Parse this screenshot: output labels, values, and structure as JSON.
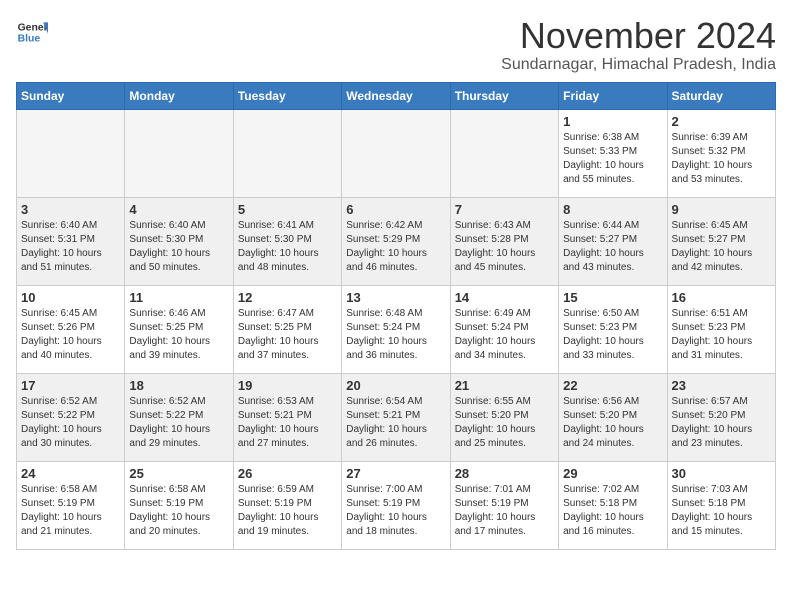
{
  "logo": {
    "line1": "General",
    "line2": "Blue"
  },
  "title": "November 2024",
  "location": "Sundarnagar, Himachal Pradesh, India",
  "weekdays": [
    "Sunday",
    "Monday",
    "Tuesday",
    "Wednesday",
    "Thursday",
    "Friday",
    "Saturday"
  ],
  "weeks": [
    [
      {
        "day": "",
        "empty": true
      },
      {
        "day": "",
        "empty": true
      },
      {
        "day": "",
        "empty": true
      },
      {
        "day": "",
        "empty": true
      },
      {
        "day": "",
        "empty": true
      },
      {
        "day": "1",
        "sunrise": "6:38 AM",
        "sunset": "5:33 PM",
        "daylight": "10 hours and 55 minutes."
      },
      {
        "day": "2",
        "sunrise": "6:39 AM",
        "sunset": "5:32 PM",
        "daylight": "10 hours and 53 minutes."
      }
    ],
    [
      {
        "day": "3",
        "sunrise": "6:40 AM",
        "sunset": "5:31 PM",
        "daylight": "10 hours and 51 minutes."
      },
      {
        "day": "4",
        "sunrise": "6:40 AM",
        "sunset": "5:30 PM",
        "daylight": "10 hours and 50 minutes."
      },
      {
        "day": "5",
        "sunrise": "6:41 AM",
        "sunset": "5:30 PM",
        "daylight": "10 hours and 48 minutes."
      },
      {
        "day": "6",
        "sunrise": "6:42 AM",
        "sunset": "5:29 PM",
        "daylight": "10 hours and 46 minutes."
      },
      {
        "day": "7",
        "sunrise": "6:43 AM",
        "sunset": "5:28 PM",
        "daylight": "10 hours and 45 minutes."
      },
      {
        "day": "8",
        "sunrise": "6:44 AM",
        "sunset": "5:27 PM",
        "daylight": "10 hours and 43 minutes."
      },
      {
        "day": "9",
        "sunrise": "6:45 AM",
        "sunset": "5:27 PM",
        "daylight": "10 hours and 42 minutes."
      }
    ],
    [
      {
        "day": "10",
        "sunrise": "6:45 AM",
        "sunset": "5:26 PM",
        "daylight": "10 hours and 40 minutes."
      },
      {
        "day": "11",
        "sunrise": "6:46 AM",
        "sunset": "5:25 PM",
        "daylight": "10 hours and 39 minutes."
      },
      {
        "day": "12",
        "sunrise": "6:47 AM",
        "sunset": "5:25 PM",
        "daylight": "10 hours and 37 minutes."
      },
      {
        "day": "13",
        "sunrise": "6:48 AM",
        "sunset": "5:24 PM",
        "daylight": "10 hours and 36 minutes."
      },
      {
        "day": "14",
        "sunrise": "6:49 AM",
        "sunset": "5:24 PM",
        "daylight": "10 hours and 34 minutes."
      },
      {
        "day": "15",
        "sunrise": "6:50 AM",
        "sunset": "5:23 PM",
        "daylight": "10 hours and 33 minutes."
      },
      {
        "day": "16",
        "sunrise": "6:51 AM",
        "sunset": "5:23 PM",
        "daylight": "10 hours and 31 minutes."
      }
    ],
    [
      {
        "day": "17",
        "sunrise": "6:52 AM",
        "sunset": "5:22 PM",
        "daylight": "10 hours and 30 minutes."
      },
      {
        "day": "18",
        "sunrise": "6:52 AM",
        "sunset": "5:22 PM",
        "daylight": "10 hours and 29 minutes."
      },
      {
        "day": "19",
        "sunrise": "6:53 AM",
        "sunset": "5:21 PM",
        "daylight": "10 hours and 27 minutes."
      },
      {
        "day": "20",
        "sunrise": "6:54 AM",
        "sunset": "5:21 PM",
        "daylight": "10 hours and 26 minutes."
      },
      {
        "day": "21",
        "sunrise": "6:55 AM",
        "sunset": "5:20 PM",
        "daylight": "10 hours and 25 minutes."
      },
      {
        "day": "22",
        "sunrise": "6:56 AM",
        "sunset": "5:20 PM",
        "daylight": "10 hours and 24 minutes."
      },
      {
        "day": "23",
        "sunrise": "6:57 AM",
        "sunset": "5:20 PM",
        "daylight": "10 hours and 23 minutes."
      }
    ],
    [
      {
        "day": "24",
        "sunrise": "6:58 AM",
        "sunset": "5:19 PM",
        "daylight": "10 hours and 21 minutes."
      },
      {
        "day": "25",
        "sunrise": "6:58 AM",
        "sunset": "5:19 PM",
        "daylight": "10 hours and 20 minutes."
      },
      {
        "day": "26",
        "sunrise": "6:59 AM",
        "sunset": "5:19 PM",
        "daylight": "10 hours and 19 minutes."
      },
      {
        "day": "27",
        "sunrise": "7:00 AM",
        "sunset": "5:19 PM",
        "daylight": "10 hours and 18 minutes."
      },
      {
        "day": "28",
        "sunrise": "7:01 AM",
        "sunset": "5:19 PM",
        "daylight": "10 hours and 17 minutes."
      },
      {
        "day": "29",
        "sunrise": "7:02 AM",
        "sunset": "5:18 PM",
        "daylight": "10 hours and 16 minutes."
      },
      {
        "day": "30",
        "sunrise": "7:03 AM",
        "sunset": "5:18 PM",
        "daylight": "10 hours and 15 minutes."
      }
    ]
  ]
}
